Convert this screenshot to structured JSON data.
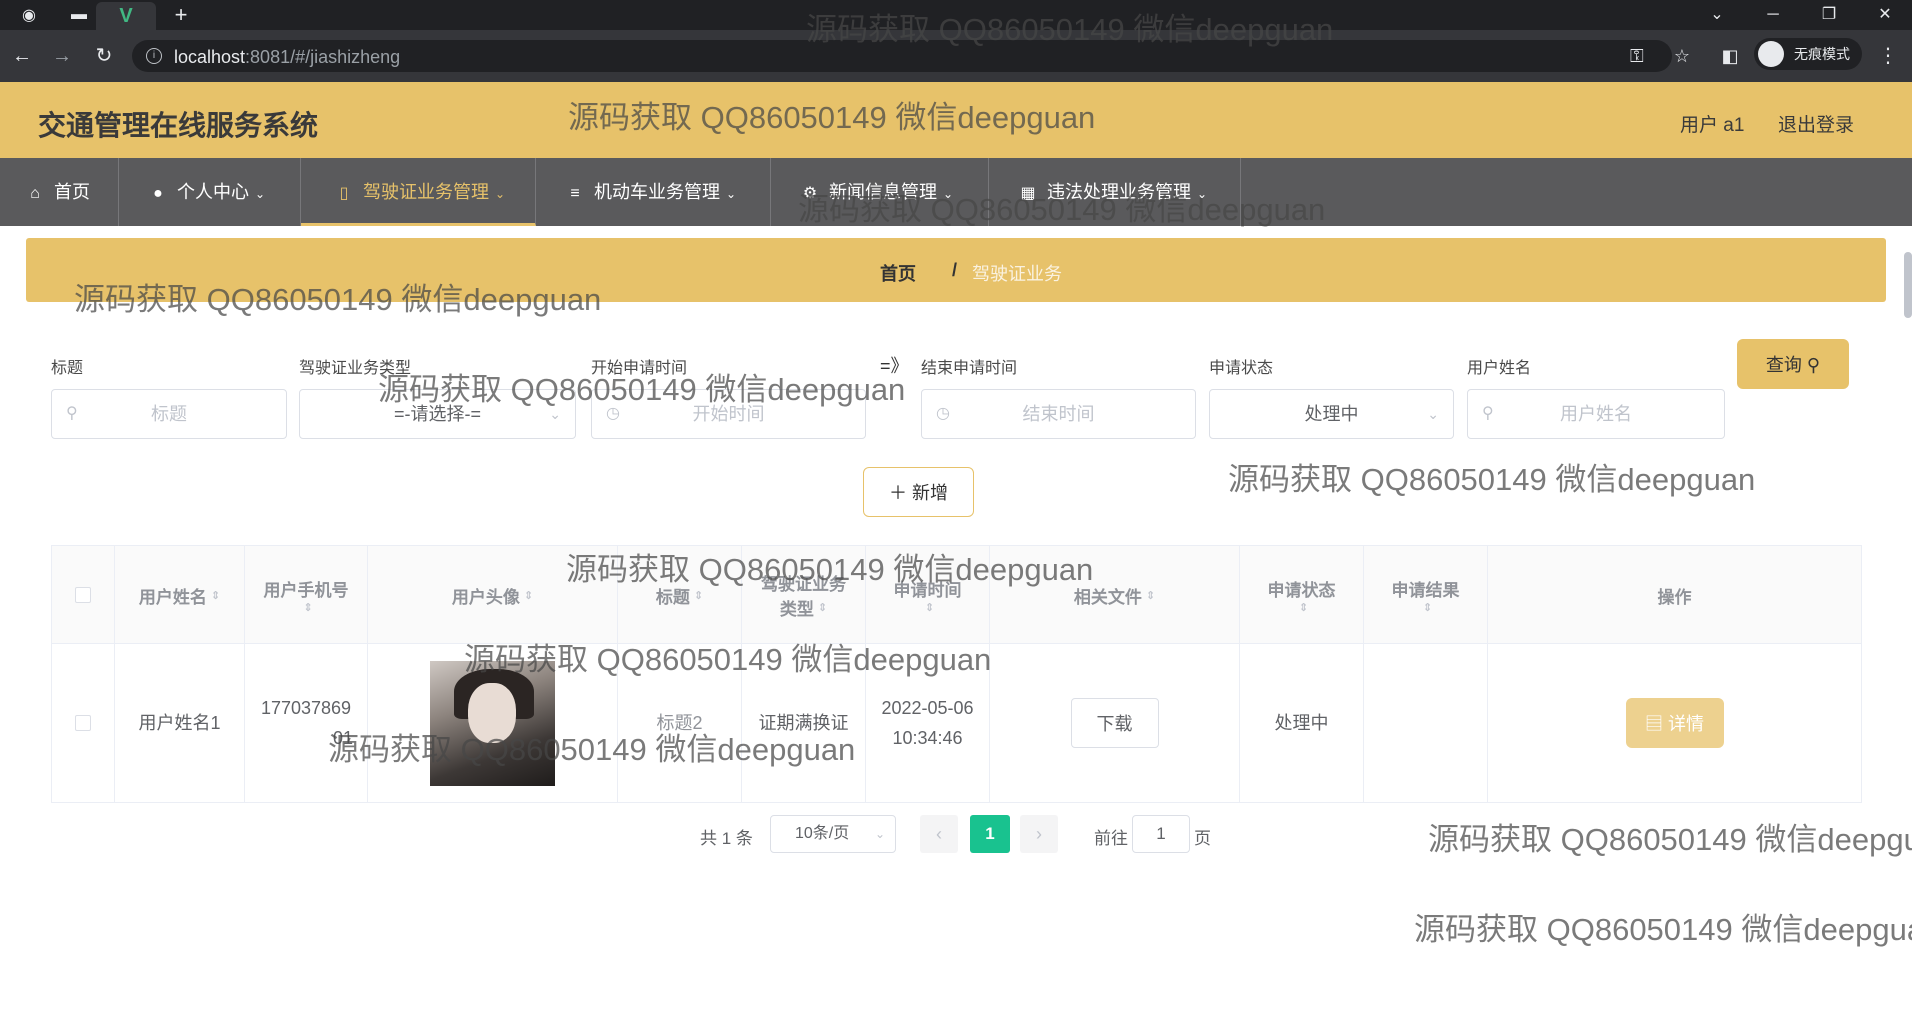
{
  "browser": {
    "url_host": "localhost",
    "url_rest": ":8081/#/jiashizheng",
    "incognito_label": "无痕模式"
  },
  "header": {
    "app_title": "交通管理在线服务系统",
    "user_label": "用户 a1",
    "logout_label": "退出登录"
  },
  "nav": {
    "items": [
      {
        "label": "首页"
      },
      {
        "label": "个人中心"
      },
      {
        "label": "驾驶证业务管理"
      },
      {
        "label": "机动车业务管理"
      },
      {
        "label": "新闻信息管理"
      },
      {
        "label": "违法处理业务管理"
      }
    ]
  },
  "breadcrumb": {
    "home": "首页",
    "separator": "/",
    "current": "驾驶证业务"
  },
  "filters": {
    "title_label": "标题",
    "title_placeholder": "标题",
    "type_label": "驾驶证业务类型",
    "type_value": "=-请选择-=",
    "start_label": "开始申请时间",
    "start_placeholder": "开始时间",
    "range_separator": "=》",
    "end_label": "结束申请时间",
    "end_placeholder": "结束时间",
    "status_label": "申请状态",
    "status_value": "处理中",
    "username_label": "用户姓名",
    "username_placeholder": "用户姓名",
    "query_label": "查询",
    "add_label": "＋ 新增"
  },
  "table": {
    "headers": {
      "username": "用户姓名",
      "phone": "用户手机号",
      "avatar": "用户头像",
      "title": "标题",
      "type_l1": "驾驶证业务",
      "type_l2": "类型",
      "time": "申请时间",
      "file": "相关文件",
      "status": "申请状态",
      "result": "申请结果",
      "actions": "操作"
    },
    "rows": [
      {
        "username": "用户姓名1",
        "phone_l1": "177037869",
        "phone_l2": "01",
        "title": "标题2",
        "type": "证期满换证",
        "date": "2022-05-06",
        "clock": "10:34:46",
        "download_label": "下载",
        "status": "处理中",
        "result": "",
        "detail_label": "详情"
      }
    ]
  },
  "pagination": {
    "total": "共 1 条",
    "page_size": "10条/页",
    "current_page": "1",
    "goto_label": "前往",
    "goto_value": "1",
    "page_suffix": "页"
  },
  "watermark": "源码获取 QQ86050149 微信deepguan"
}
